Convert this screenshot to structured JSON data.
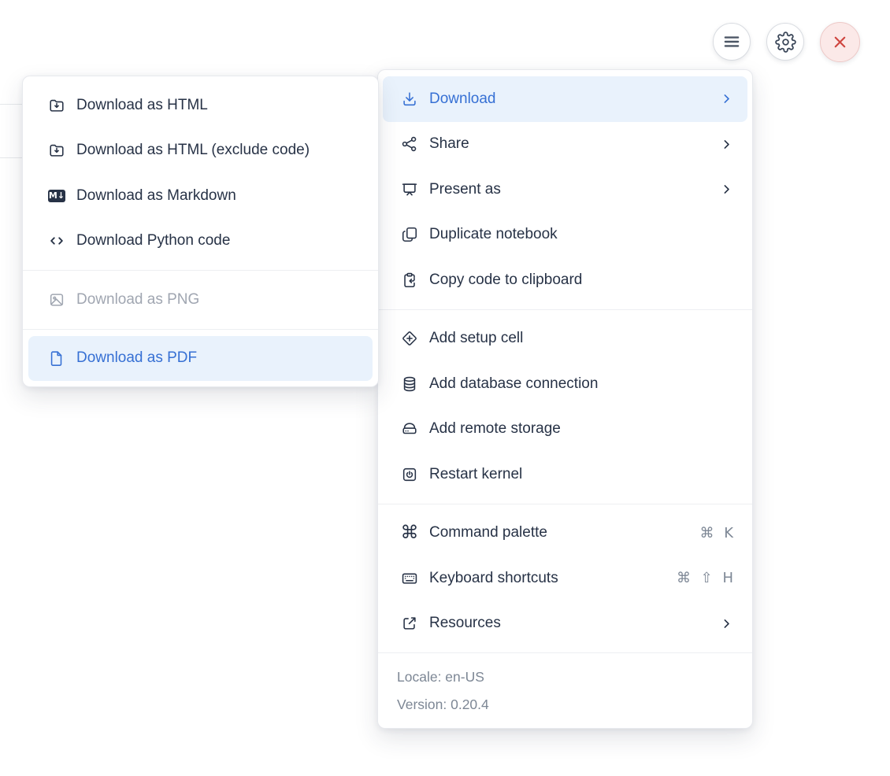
{
  "topbar": {
    "menu_button": {
      "icon": "hamburger-icon"
    },
    "settings_button": {
      "icon": "gear-icon"
    },
    "close_button": {
      "icon": "close-icon"
    }
  },
  "download_submenu": {
    "items": [
      {
        "label": "Download as HTML",
        "icon": "folder-download-icon",
        "state": "normal"
      },
      {
        "label": "Download as HTML (exclude code)",
        "icon": "folder-download-icon",
        "state": "normal"
      },
      {
        "label": "Download as Markdown",
        "icon": "markdown-icon",
        "state": "normal"
      },
      {
        "label": "Download Python code",
        "icon": "code-icon",
        "state": "normal"
      },
      {
        "label": "Download as PNG",
        "icon": "image-icon",
        "state": "disabled"
      },
      {
        "label": "Download as PDF",
        "icon": "file-icon",
        "state": "highlighted"
      }
    ],
    "markdown_badge": "M↓"
  },
  "main_menu": {
    "items": [
      {
        "label": "Download",
        "icon": "download-icon",
        "has_submenu": true,
        "state": "highlighted"
      },
      {
        "label": "Share",
        "icon": "share-icon",
        "has_submenu": true
      },
      {
        "label": "Present as",
        "icon": "presentation-icon",
        "has_submenu": true
      },
      {
        "label": "Duplicate notebook",
        "icon": "duplicate-icon"
      },
      {
        "label": "Copy code to clipboard",
        "icon": "clipboard-icon"
      },
      {
        "label": "Add setup cell",
        "icon": "diamond-plus-icon"
      },
      {
        "label": "Add database connection",
        "icon": "database-icon"
      },
      {
        "label": "Add remote storage",
        "icon": "storage-icon"
      },
      {
        "label": "Restart kernel",
        "icon": "power-icon"
      },
      {
        "label": "Command palette",
        "icon": "command-icon",
        "shortcut": "⌘ K"
      },
      {
        "label": "Keyboard shortcuts",
        "icon": "keyboard-icon",
        "shortcut": "⌘ ⇧ H"
      },
      {
        "label": "Resources",
        "icon": "external-link-icon",
        "has_submenu": true
      }
    ],
    "command_glyph": "⌘",
    "footer": {
      "locale": "Locale: en-US",
      "version": "Version: 0.20.4"
    }
  },
  "colors": {
    "accent_blue": "#3670d4",
    "highlight_bg": "#e9f2fc",
    "text_dark": "#273246",
    "text_disabled": "#a0a6b1",
    "text_muted": "#7d8795",
    "divider": "#edeff2",
    "close_red": "#cf4640",
    "close_bg": "#fbe9e8",
    "close_border": "#edc9c7",
    "button_border": "#d9dce1"
  }
}
